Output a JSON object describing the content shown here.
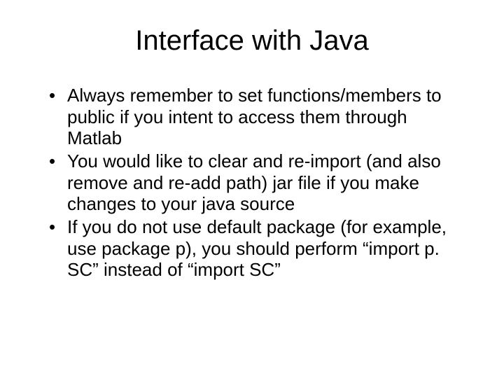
{
  "slide": {
    "title": "Interface with Java",
    "bullets": [
      "Always remember to set functions/members to public if you intent to access them through Matlab",
      "You would like to clear and re-import (and also remove and re-add path) jar file if you make changes to your java source",
      "If you do not use default package (for example, use package p), you should perform “import p. SC” instead of “import SC”"
    ]
  }
}
